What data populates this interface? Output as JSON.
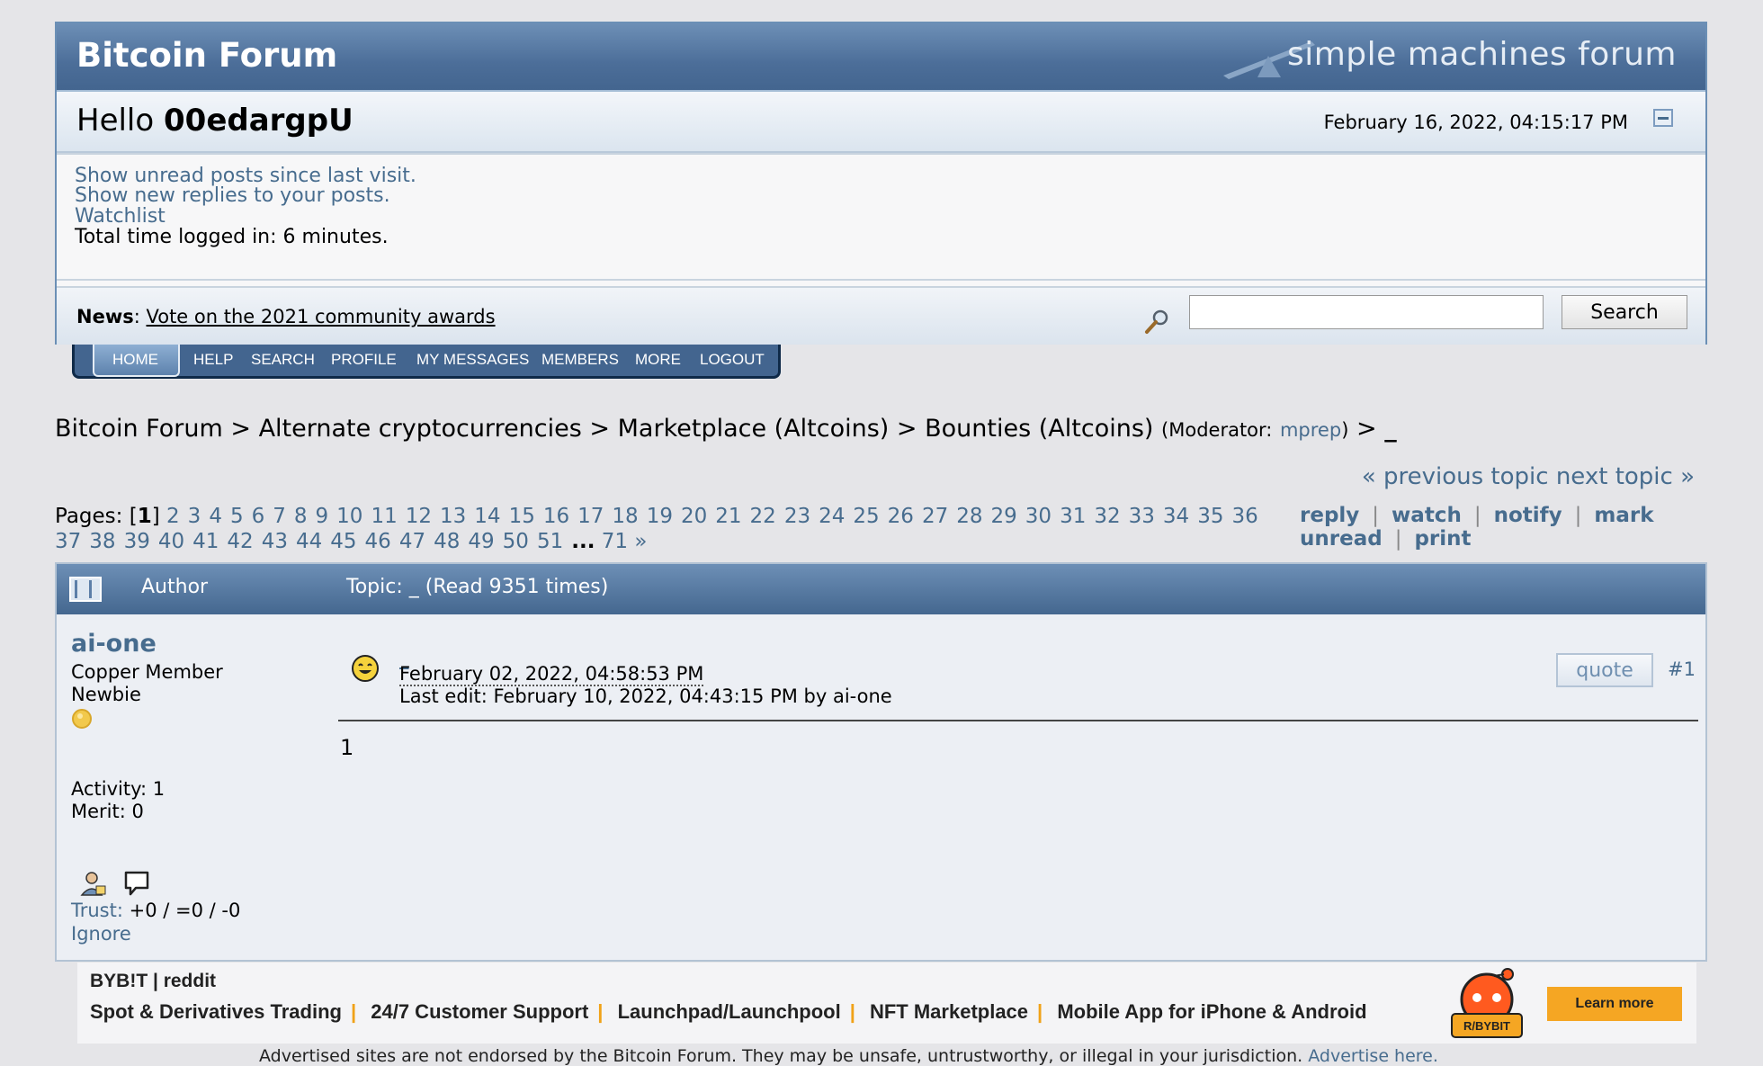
{
  "header": {
    "forum_title": "Bitcoin Forum",
    "logo_text": "simple machines forum",
    "hello_prefix": "Hello",
    "username": "00edargpU",
    "datetime": "February 16, 2022, 04:15:17 PM"
  },
  "user_links": {
    "unread": "Show unread posts since last visit.",
    "replies": "Show new replies to your posts.",
    "watchlist": "Watchlist",
    "time_logged": "Total time logged in: 6 minutes."
  },
  "news": {
    "label": "News",
    "headline": "Vote on the 2021 community awards"
  },
  "search": {
    "value": "",
    "button": "Search"
  },
  "menu": [
    "HOME",
    "HELP",
    "SEARCH",
    "PROFILE",
    "MY MESSAGES",
    "MEMBERS",
    "MORE",
    "LOGOUT"
  ],
  "breadcrumb": {
    "home": "Bitcoin Forum",
    "category": "Alternate cryptocurrencies",
    "board": "Marketplace (Altcoins)",
    "subboard": "Bounties (Altcoins)",
    "moderator_label": "(Moderator:",
    "moderator": "mprep",
    "moderator_close": ")",
    "topic": "_"
  },
  "topic_nav": {
    "previous": "« previous topic",
    "next": "next topic »"
  },
  "pagination": {
    "label": "Pages:",
    "current": "1",
    "row1": [
      "2",
      "3",
      "4",
      "5",
      "6",
      "7",
      "8",
      "9",
      "10",
      "11",
      "12",
      "13",
      "14",
      "15",
      "16",
      "17",
      "18",
      "19",
      "20",
      "21",
      "22",
      "23",
      "24",
      "25",
      "26",
      "27",
      "28",
      "29",
      "30",
      "31",
      "32",
      "33",
      "34",
      "35",
      "36"
    ],
    "row2": [
      "37",
      "38",
      "39",
      "40",
      "41",
      "42",
      "43",
      "44",
      "45",
      "46",
      "47",
      "48",
      "49",
      "50",
      "51"
    ],
    "ellipsis": "...",
    "last": "71",
    "next": "»"
  },
  "actions": {
    "reply": "reply",
    "watch": "watch",
    "notify": "notify",
    "mark": "mark",
    "unread": "unread",
    "print": "print"
  },
  "topic_header": {
    "author": "Author",
    "topic": "Topic: _  (Read 9351 times)"
  },
  "post": {
    "author": "ai-one",
    "rank1": "Copper Member",
    "rank2": "Newbie",
    "activity": "Activity: 1",
    "merit": "Merit: 0",
    "trust_label": "Trust:",
    "trust_value": "+0 / =0 / -0",
    "ignore": "Ignore",
    "subject": "_",
    "date": "February 02, 2022, 04:58:53 PM",
    "last_edit": "Last edit: February 10, 2022, 04:43:15 PM by ai-one",
    "quote": "quote",
    "number": "#1",
    "body": "1"
  },
  "ad": {
    "brand": "BYB!T | reddit",
    "items": [
      "Spot & Derivatives Trading",
      "24/7 Customer Support",
      "Launchpad/Launchpool",
      "NFT Marketplace",
      "Mobile App for iPhone & Android"
    ],
    "mascot_text": "R/BYBIT",
    "button": "Learn more"
  },
  "disclaimer": {
    "text": "Advertised sites are not endorsed by the Bitcoin Forum. They may be unsafe, untrustworthy, or illegal in your jurisdiction.",
    "link": "Advertise here."
  },
  "colors": {
    "link": "#476c8e",
    "header_blue": "#4c6e99",
    "ad_accent": "#f5a623"
  }
}
